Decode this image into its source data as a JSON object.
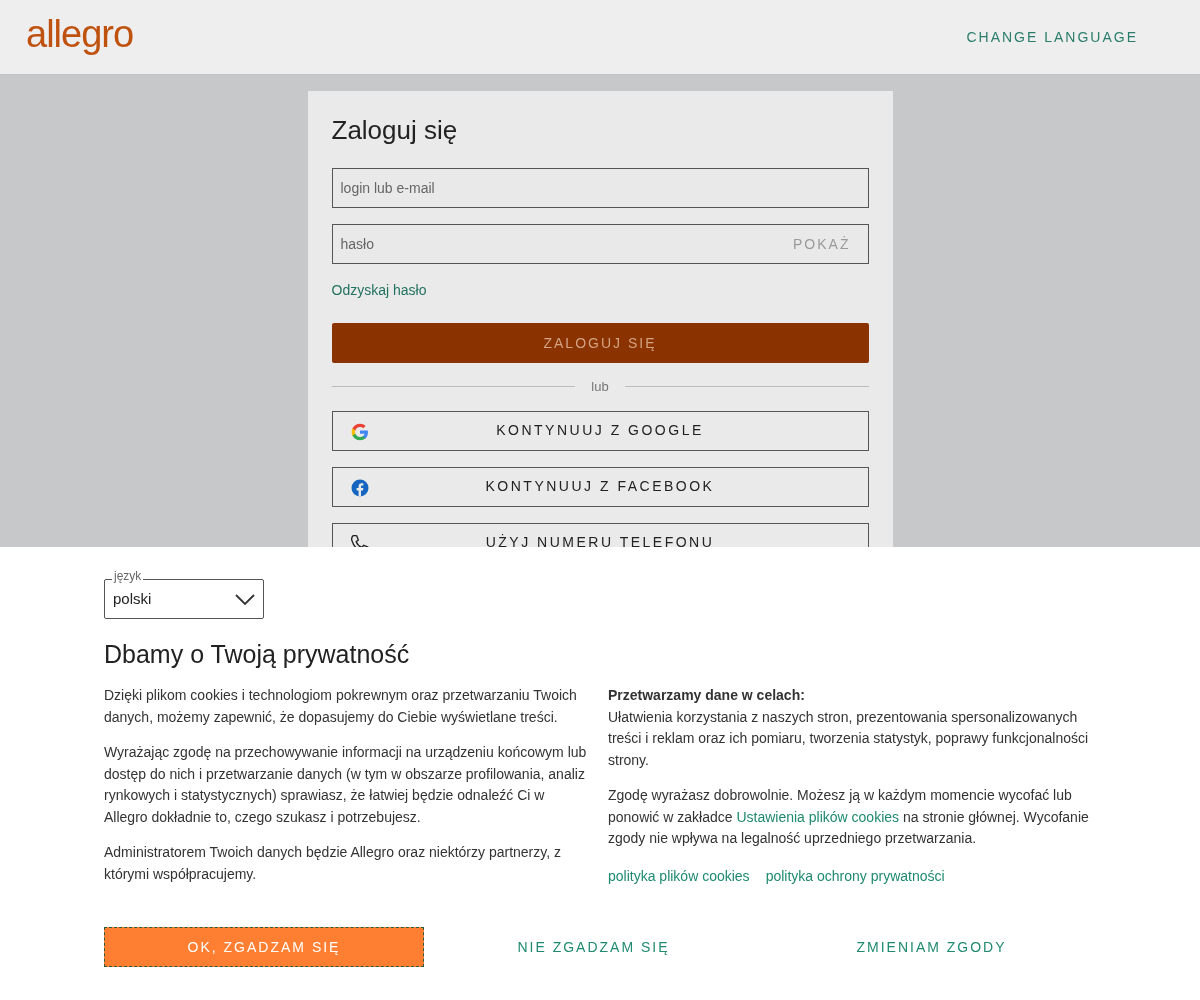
{
  "header": {
    "logo": "allegro",
    "change_language": "CHANGE LANGUAGE"
  },
  "login": {
    "title": "Zaloguj się",
    "login_field": {
      "placeholder": "login lub e-mail"
    },
    "password_field": {
      "placeholder": "hasło",
      "toggle": "POKAŻ"
    },
    "recover_link": "Odzyskaj hasło",
    "submit": "ZALOGUJ SIĘ",
    "divider": "lub",
    "social": [
      {
        "kind": "google",
        "label": "KONTYNUUJ Z GOOGLE"
      },
      {
        "kind": "facebook",
        "label": "KONTYNUUJ Z FACEBOOK"
      },
      {
        "kind": "phone",
        "label": "UŻYJ NUMERU TELEFONU"
      }
    ]
  },
  "cookie_panel": {
    "language_select": {
      "label": "język",
      "value": "polski"
    },
    "title": "Dbamy o Twoją prywatność",
    "left_paragraphs": [
      "Dzięki plikom cookies i technologiom pokrewnym oraz przetwarzaniu Twoich danych, możemy zapewnić, że dopasujemy do Ciebie wyświetlane treści.",
      "Wyrażając zgodę na przechowywanie informacji na urządzeniu końcowym lub dostęp do nich i przetwarzanie danych (w tym w obszarze profilowania, analiz rynkowych i statystycznych) sprawiasz, że łatwiej będzie odnaleźć Ci w Allegro dokładnie to, czego szukasz i potrzebujesz.",
      "Administratorem Twoich danych będzie Allegro oraz niektórzy partnerzy, z którymi współpracujemy."
    ],
    "purposes_heading": "Przetwarzamy dane w celach:",
    "purposes_text": "Ułatwienia korzystania z naszych stron, prezentowania spersonalizowanych treści i reklam oraz ich pomiaru, tworzenia statystyk, poprawy funkcjonalności strony.",
    "consent": {
      "before": "Zgodę wyrażasz dobrowolnie. Możesz ją w każdym momencie wycofać lub ponowić w zakładce ",
      "link": "Ustawienia plików cookies",
      "after": " na stronie głównej. Wycofanie zgody nie wpływa na legalność uprzedniego przetwarzania."
    },
    "policy_links": [
      "polityka plików cookies",
      "polityka ochrony prywatności"
    ],
    "buttons": [
      {
        "kind": "primary",
        "label": "OK, ZGADZAM SIĘ"
      },
      {
        "kind": "text",
        "label": "NIE ZGADZAM SIĘ"
      },
      {
        "kind": "text",
        "label": "ZMIENIAM ZGODY"
      }
    ]
  }
}
